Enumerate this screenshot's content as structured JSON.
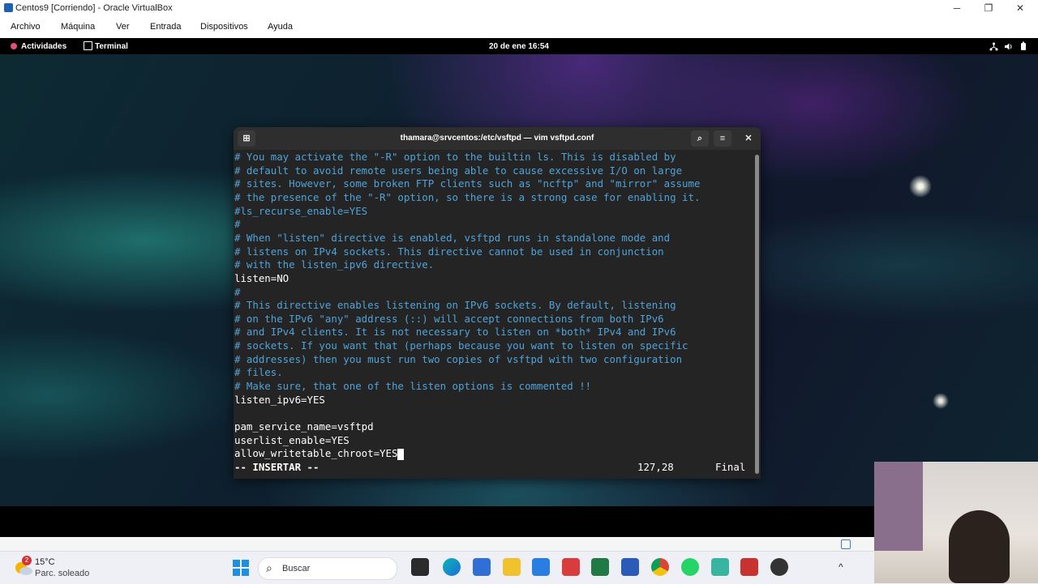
{
  "host": {
    "title": "Centos9 [Corriendo] - Oracle VirtualBox",
    "menu": [
      "Archivo",
      "Máquina",
      "Ver",
      "Entrada",
      "Dispositivos",
      "Ayuda"
    ]
  },
  "gnome": {
    "activities": "Actividades",
    "app": "Terminal",
    "clock": "20 de ene  16:54"
  },
  "terminal": {
    "title": "thamara@srvcentos:/etc/vsftpd — vim vsftpd.conf",
    "lines": [
      "# You may activate the \"-R\" option to the builtin ls. This is disabled by",
      "# default to avoid remote users being able to cause excessive I/O on large",
      "# sites. However, some broken FTP clients such as \"ncftp\" and \"mirror\" assume",
      "# the presence of the \"-R\" option, so there is a strong case for enabling it.",
      "#ls_recurse_enable=YES",
      "#",
      "# When \"listen\" directive is enabled, vsftpd runs in standalone mode and",
      "# listens on IPv4 sockets. This directive cannot be used in conjunction",
      "# with the listen_ipv6 directive.",
      "listen=NO",
      "#",
      "# This directive enables listening on IPv6 sockets. By default, listening",
      "# on the IPv6 \"any\" address (::) will accept connections from both IPv6",
      "# and IPv4 clients. It is not necessary to listen on *both* IPv4 and IPv6",
      "# sockets. If you want that (perhaps because you want to listen on specific",
      "# addresses) then you must run two copies of vsftpd with two configuration",
      "# files.",
      "# Make sure, that one of the listen options is commented !!",
      "listen_ipv6=YES",
      "",
      "pam_service_name=vsftpd",
      "userlist_enable=YES",
      "allow_writetable_chroot=YES"
    ],
    "mode": "-- INSERTAR --",
    "position": "127,28",
    "scroll_pos": "Final"
  },
  "taskbar": {
    "weather_temp": "15°C",
    "weather_desc": "Parc. soleado",
    "weather_badge": "2",
    "search_placeholder": "Buscar"
  },
  "colors": {
    "comment": "#4fa3d9",
    "text": "#ffffff",
    "terminal_bg": "#242424"
  }
}
